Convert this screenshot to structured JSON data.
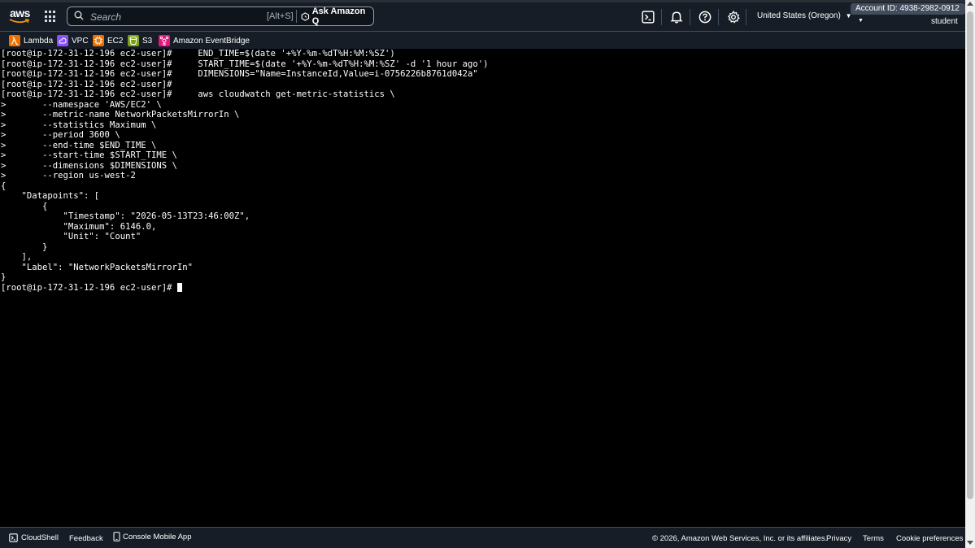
{
  "header": {
    "logo_text": "aws",
    "search": {
      "placeholder": "Search",
      "shortcut": "[Alt+S]",
      "ask_q_label": "Ask Amazon Q"
    },
    "region": "United States (Oregon)",
    "account": "Account ID: 4938-2982-0912",
    "user": "student"
  },
  "favorites": [
    {
      "label": "Lambda",
      "color": "#ed7100"
    },
    {
      "label": "VPC",
      "color": "#8c4fff"
    },
    {
      "label": "EC2",
      "color": "#ed7100"
    },
    {
      "label": "S3",
      "color": "#7aa116"
    },
    {
      "label": "Amazon EventBridge",
      "color": "#e7157b"
    }
  ],
  "terminal": {
    "lines": [
      "[root@ip-172-31-12-196 ec2-user]#     END_TIME=$(date '+%Y-%m-%dT%H:%M:%SZ')",
      "[root@ip-172-31-12-196 ec2-user]#     START_TIME=$(date '+%Y-%m-%dT%H:%M:%SZ' -d '1 hour ago')",
      "[root@ip-172-31-12-196 ec2-user]#     DIMENSIONS=\"Name=InstanceId,Value=i-0756226b8761d042a\"",
      "[root@ip-172-31-12-196 ec2-user]#",
      "[root@ip-172-31-12-196 ec2-user]#     aws cloudwatch get-metric-statistics \\",
      ">       --namespace 'AWS/EC2' \\",
      ">       --metric-name NetworkPacketsMirrorIn \\",
      ">       --statistics Maximum \\",
      ">       --period 3600 \\",
      ">       --end-time $END_TIME \\",
      ">       --start-time $START_TIME \\",
      ">       --dimensions $DIMENSIONS \\",
      ">       --region us-west-2",
      "{",
      "    \"Datapoints\": [",
      "        {",
      "            \"Timestamp\": \"2026-05-13T23:46:00Z\",",
      "            \"Maximum\": 6146.0,",
      "            \"Unit\": \"Count\"",
      "        }",
      "    ],",
      "    \"Label\": \"NetworkPacketsMirrorIn\"",
      "}"
    ],
    "prompt": "[root@ip-172-31-12-196 ec2-user]# "
  },
  "footer": {
    "cloudshell": "CloudShell",
    "feedback": "Feedback",
    "mobile_app": "Console Mobile App",
    "copyright": "© 2026, Amazon Web Services, Inc. or its affiliates.",
    "privacy": "Privacy",
    "terms": "Terms",
    "cookies": "Cookie preferences"
  }
}
